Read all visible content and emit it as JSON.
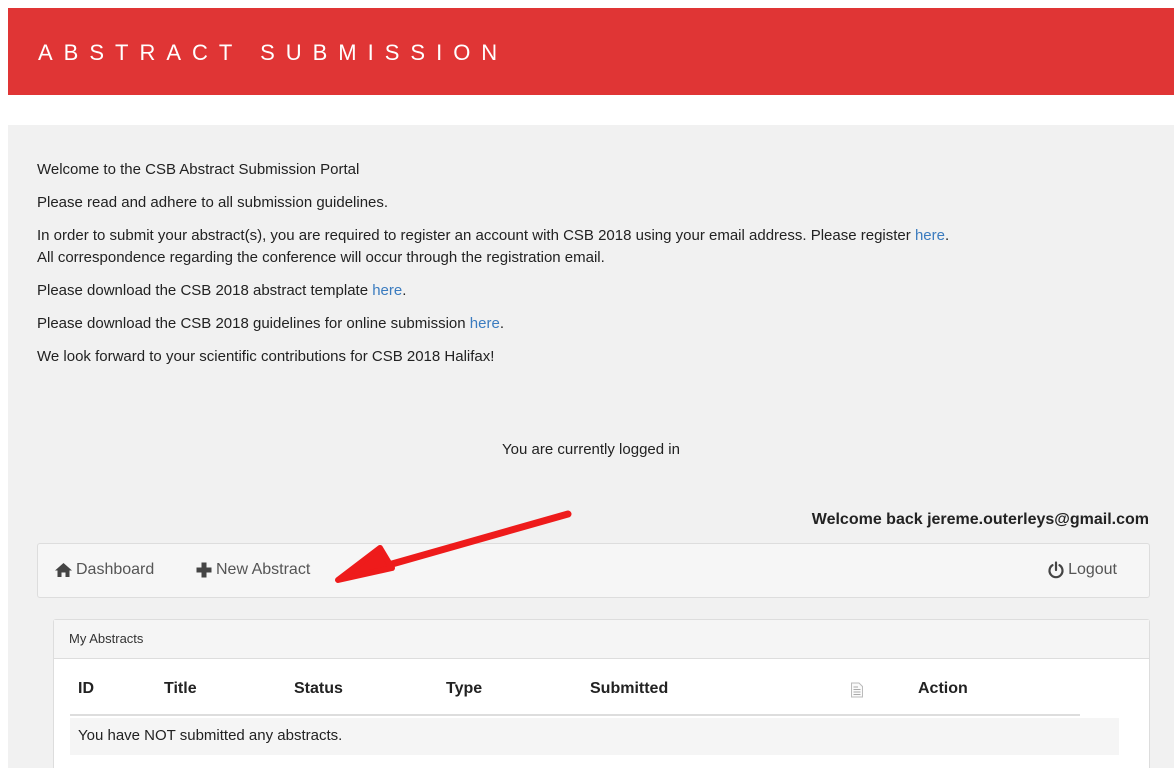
{
  "header": {
    "title": "ABSTRACT SUBMISSION"
  },
  "intro": {
    "welcome": "Welcome to the CSB Abstract Submission Portal",
    "guidelines": "Please read and adhere to all submission guidelines.",
    "register_text": "In order to submit your abstract(s), you are required to register an account with CSB 2018 using your email address. Please register ",
    "register_link": "here",
    "register_tail": ".",
    "correspondence": "All correspondence regarding the conference will occur through the registration email.",
    "template_text": "Please download the CSB 2018 abstract template ",
    "template_link": "here",
    "template_tail": ".",
    "online_text": "Please download the CSB 2018 guidelines for online submission ",
    "online_link": "here",
    "online_tail": ".",
    "look_forward": "We look forward to your scientific contributions for CSB 2018 Halifax!"
  },
  "status": {
    "logged_in": "You are currently logged in",
    "welcome_back": "Welcome back jereme.outerleys@gmail.com"
  },
  "nav": {
    "dashboard": "Dashboard",
    "new_abstract": "New Abstract",
    "logout": "Logout"
  },
  "abstracts": {
    "heading": "My Abstracts",
    "columns": [
      "ID",
      "Title",
      "Status",
      "Type",
      "Submitted",
      "Action"
    ],
    "empty_message": "You have NOT submitted any abstracts."
  },
  "icons": {
    "dashboard": "home-icon",
    "new_abstract": "plus-icon",
    "logout": "power-icon",
    "file": "document-icon"
  },
  "colors": {
    "header_bg": "#e03535",
    "link": "#3a7bbf",
    "annotation_arrow": "#ee1b1b"
  }
}
